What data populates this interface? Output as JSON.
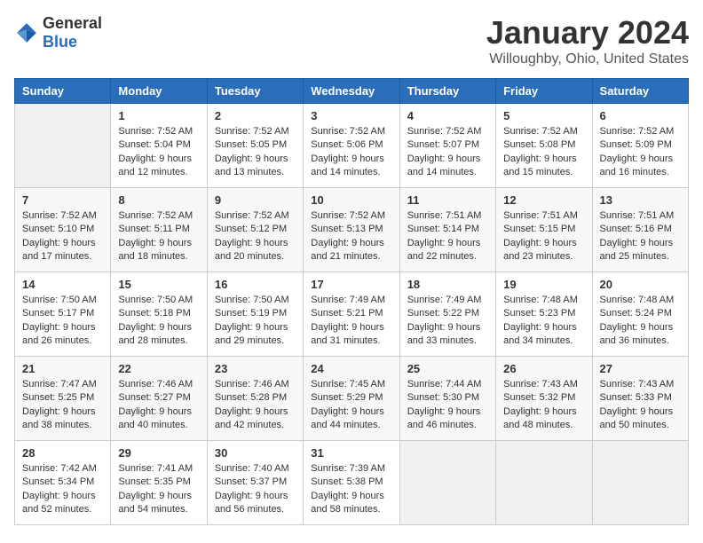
{
  "logo": {
    "general": "General",
    "blue": "Blue"
  },
  "header": {
    "title": "January 2024",
    "subtitle": "Willoughby, Ohio, United States"
  },
  "days_of_week": [
    "Sunday",
    "Monday",
    "Tuesday",
    "Wednesday",
    "Thursday",
    "Friday",
    "Saturday"
  ],
  "weeks": [
    [
      {
        "day": "",
        "empty": true
      },
      {
        "day": "1",
        "sunrise": "Sunrise: 7:52 AM",
        "sunset": "Sunset: 5:04 PM",
        "daylight": "Daylight: 9 hours and 12 minutes."
      },
      {
        "day": "2",
        "sunrise": "Sunrise: 7:52 AM",
        "sunset": "Sunset: 5:05 PM",
        "daylight": "Daylight: 9 hours and 13 minutes."
      },
      {
        "day": "3",
        "sunrise": "Sunrise: 7:52 AM",
        "sunset": "Sunset: 5:06 PM",
        "daylight": "Daylight: 9 hours and 14 minutes."
      },
      {
        "day": "4",
        "sunrise": "Sunrise: 7:52 AM",
        "sunset": "Sunset: 5:07 PM",
        "daylight": "Daylight: 9 hours and 14 minutes."
      },
      {
        "day": "5",
        "sunrise": "Sunrise: 7:52 AM",
        "sunset": "Sunset: 5:08 PM",
        "daylight": "Daylight: 9 hours and 15 minutes."
      },
      {
        "day": "6",
        "sunrise": "Sunrise: 7:52 AM",
        "sunset": "Sunset: 5:09 PM",
        "daylight": "Daylight: 9 hours and 16 minutes."
      }
    ],
    [
      {
        "day": "7",
        "sunrise": "Sunrise: 7:52 AM",
        "sunset": "Sunset: 5:10 PM",
        "daylight": "Daylight: 9 hours and 17 minutes."
      },
      {
        "day": "8",
        "sunrise": "Sunrise: 7:52 AM",
        "sunset": "Sunset: 5:11 PM",
        "daylight": "Daylight: 9 hours and 18 minutes."
      },
      {
        "day": "9",
        "sunrise": "Sunrise: 7:52 AM",
        "sunset": "Sunset: 5:12 PM",
        "daylight": "Daylight: 9 hours and 20 minutes."
      },
      {
        "day": "10",
        "sunrise": "Sunrise: 7:52 AM",
        "sunset": "Sunset: 5:13 PM",
        "daylight": "Daylight: 9 hours and 21 minutes."
      },
      {
        "day": "11",
        "sunrise": "Sunrise: 7:51 AM",
        "sunset": "Sunset: 5:14 PM",
        "daylight": "Daylight: 9 hours and 22 minutes."
      },
      {
        "day": "12",
        "sunrise": "Sunrise: 7:51 AM",
        "sunset": "Sunset: 5:15 PM",
        "daylight": "Daylight: 9 hours and 23 minutes."
      },
      {
        "day": "13",
        "sunrise": "Sunrise: 7:51 AM",
        "sunset": "Sunset: 5:16 PM",
        "daylight": "Daylight: 9 hours and 25 minutes."
      }
    ],
    [
      {
        "day": "14",
        "sunrise": "Sunrise: 7:50 AM",
        "sunset": "Sunset: 5:17 PM",
        "daylight": "Daylight: 9 hours and 26 minutes."
      },
      {
        "day": "15",
        "sunrise": "Sunrise: 7:50 AM",
        "sunset": "Sunset: 5:18 PM",
        "daylight": "Daylight: 9 hours and 28 minutes."
      },
      {
        "day": "16",
        "sunrise": "Sunrise: 7:50 AM",
        "sunset": "Sunset: 5:19 PM",
        "daylight": "Daylight: 9 hours and 29 minutes."
      },
      {
        "day": "17",
        "sunrise": "Sunrise: 7:49 AM",
        "sunset": "Sunset: 5:21 PM",
        "daylight": "Daylight: 9 hours and 31 minutes."
      },
      {
        "day": "18",
        "sunrise": "Sunrise: 7:49 AM",
        "sunset": "Sunset: 5:22 PM",
        "daylight": "Daylight: 9 hours and 33 minutes."
      },
      {
        "day": "19",
        "sunrise": "Sunrise: 7:48 AM",
        "sunset": "Sunset: 5:23 PM",
        "daylight": "Daylight: 9 hours and 34 minutes."
      },
      {
        "day": "20",
        "sunrise": "Sunrise: 7:48 AM",
        "sunset": "Sunset: 5:24 PM",
        "daylight": "Daylight: 9 hours and 36 minutes."
      }
    ],
    [
      {
        "day": "21",
        "sunrise": "Sunrise: 7:47 AM",
        "sunset": "Sunset: 5:25 PM",
        "daylight": "Daylight: 9 hours and 38 minutes."
      },
      {
        "day": "22",
        "sunrise": "Sunrise: 7:46 AM",
        "sunset": "Sunset: 5:27 PM",
        "daylight": "Daylight: 9 hours and 40 minutes."
      },
      {
        "day": "23",
        "sunrise": "Sunrise: 7:46 AM",
        "sunset": "Sunset: 5:28 PM",
        "daylight": "Daylight: 9 hours and 42 minutes."
      },
      {
        "day": "24",
        "sunrise": "Sunrise: 7:45 AM",
        "sunset": "Sunset: 5:29 PM",
        "daylight": "Daylight: 9 hours and 44 minutes."
      },
      {
        "day": "25",
        "sunrise": "Sunrise: 7:44 AM",
        "sunset": "Sunset: 5:30 PM",
        "daylight": "Daylight: 9 hours and 46 minutes."
      },
      {
        "day": "26",
        "sunrise": "Sunrise: 7:43 AM",
        "sunset": "Sunset: 5:32 PM",
        "daylight": "Daylight: 9 hours and 48 minutes."
      },
      {
        "day": "27",
        "sunrise": "Sunrise: 7:43 AM",
        "sunset": "Sunset: 5:33 PM",
        "daylight": "Daylight: 9 hours and 50 minutes."
      }
    ],
    [
      {
        "day": "28",
        "sunrise": "Sunrise: 7:42 AM",
        "sunset": "Sunset: 5:34 PM",
        "daylight": "Daylight: 9 hours and 52 minutes."
      },
      {
        "day": "29",
        "sunrise": "Sunrise: 7:41 AM",
        "sunset": "Sunset: 5:35 PM",
        "daylight": "Daylight: 9 hours and 54 minutes."
      },
      {
        "day": "30",
        "sunrise": "Sunrise: 7:40 AM",
        "sunset": "Sunset: 5:37 PM",
        "daylight": "Daylight: 9 hours and 56 minutes."
      },
      {
        "day": "31",
        "sunrise": "Sunrise: 7:39 AM",
        "sunset": "Sunset: 5:38 PM",
        "daylight": "Daylight: 9 hours and 58 minutes."
      },
      {
        "day": "",
        "empty": true
      },
      {
        "day": "",
        "empty": true
      },
      {
        "day": "",
        "empty": true
      }
    ]
  ]
}
